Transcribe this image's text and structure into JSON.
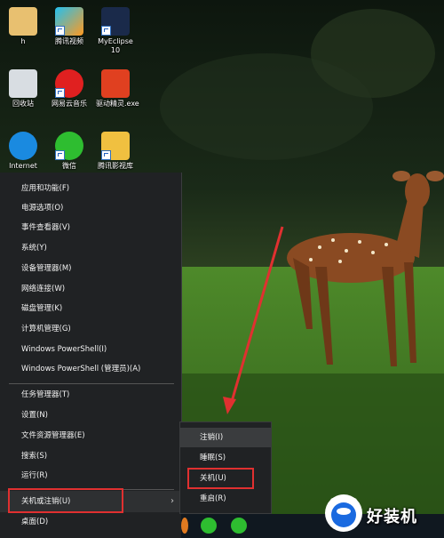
{
  "desktop": {
    "icons": [
      {
        "label": "h"
      },
      {
        "label": "腾讯视频"
      },
      {
        "label": "MyEclipse 10"
      },
      {
        "label": "回收站"
      },
      {
        "label": "网易云音乐"
      },
      {
        "label": "驱动精灵.exe"
      },
      {
        "label": "Internet"
      },
      {
        "label": "微信"
      },
      {
        "label": "腾讯影视库"
      }
    ]
  },
  "winx_menu": {
    "items": [
      {
        "label": "应用和功能(F)"
      },
      {
        "label": "电源选项(O)"
      },
      {
        "label": "事件查看器(V)"
      },
      {
        "label": "系统(Y)"
      },
      {
        "label": "设备管理器(M)"
      },
      {
        "label": "网络连接(W)"
      },
      {
        "label": "磁盘管理(K)"
      },
      {
        "label": "计算机管理(G)"
      },
      {
        "label": "Windows PowerShell(I)"
      },
      {
        "label": "Windows PowerShell (管理员)(A)"
      },
      {
        "label": "任务管理器(T)"
      },
      {
        "label": "设置(N)"
      },
      {
        "label": "文件资源管理器(E)"
      },
      {
        "label": "搜索(S)"
      },
      {
        "label": "运行(R)"
      },
      {
        "label": "关机或注销(U)"
      },
      {
        "label": "桌面(D)"
      }
    ],
    "submenu_arrow": "›"
  },
  "shutdown_submenu": {
    "items": [
      {
        "label": "注销(I)"
      },
      {
        "label": "睡眠(S)"
      },
      {
        "label": "关机(U)"
      },
      {
        "label": "重启(R)"
      }
    ]
  },
  "watermark": {
    "text": "好装机"
  },
  "colors": {
    "menu_bg": "#202224",
    "highlight": "#e03030"
  }
}
